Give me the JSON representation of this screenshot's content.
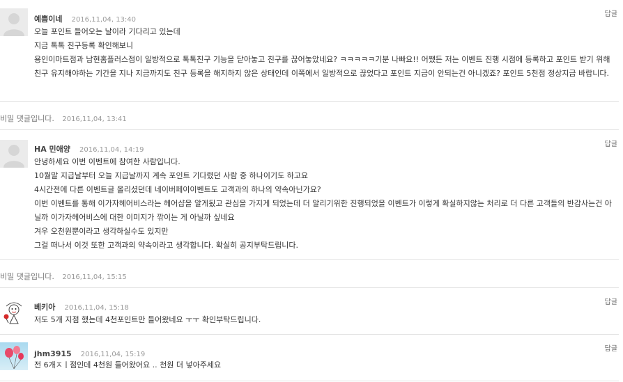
{
  "comments": [
    {
      "author": "예쁨이네",
      "date": "2016,11,04, 13:40",
      "reply_label": "답글",
      "avatar": "default-avatar-icon",
      "lines": [
        "오늘 포인트 들어오는 날이라 기다리고 있는데",
        "지금 톡톡 친구등록 확인해보니",
        "용인이마트점과 남현홈플러스점이 일방적으로 톡톡친구 기능을 닫아놓고 친구를 끊어놓았네요? ㅋㅋㅋㅋㅋ기분 나빠요!! 어쨌든 저는 이벤트 진행 시점에 등록하고 포인트 받기 위해 친구 유지해야하는 기간을 지나 지금까지도 친구 등록을 해지하지 않은 상태인데 이쪽에서 일방적으로 끊었다고 포인트 지급이 안되는건 아니겠죠? 포인트 5천점 정상지급 바랍니다."
      ]
    },
    {
      "author": "HA 민애양",
      "date": "2016,11,04, 14:19",
      "reply_label": "답글",
      "avatar": "default-avatar-icon",
      "lines": [
        "안녕하세요 이번 이벤트에 참여한 사람입니다.",
        "10월말 지급날부터 오늘 지급날까지 계속 포인트 기다렸던 사람 중 하나이기도 하고요",
        "4시간전에 다른 이벤트글 올리셨던데 네이버페이이벤트도 고객과의 하나의 약속아닌가요?",
        "이번 이벤트를 통해 이가자헤어비스라는 헤어샵을 알게됬고 관심을 가지게 되었는데 더 알리기위한 진행되었을 이벤트가 이렇게 확실하지않는 처리로 더 다른 고객들의 반감사는건 아닐까 이가자헤어비스에 대한 이미지가 깎이는 게 아닐까 싶네요",
        "겨우 오천원뿐이라고 생각하실수도 있지만",
        "그걸 떠나서 이것 또한 고객과의 약속이라고 생각합니다. 확실히 공지부탁드립니다."
      ]
    },
    {
      "author": "베키아",
      "date": "2016,11,04, 15:18",
      "reply_label": "답글",
      "avatar": "cartoon-avatar-icon",
      "lines": [
        "저도 5개 지점 했는데 4천포인트만 들어왔네요 ㅜㅜ 확인부탁드립니다."
      ]
    },
    {
      "author": "jhm3915",
      "date": "2016,11,04, 15:19",
      "reply_label": "답글",
      "avatar": "balloon-avatar-icon",
      "lines": [
        "전 6개ㅈㅣ점인데 4천원 들어왔어요 .. 천원 더 넣아주세요"
      ]
    }
  ],
  "secret_comments": [
    {
      "text": "비밀 댓글입니다.",
      "date": "2016,11,04, 13:41"
    },
    {
      "text": "비밀 댓글입니다.",
      "date": "2016,11,04, 15:15"
    }
  ],
  "colors": {
    "avatar_default": "#ebebeb",
    "divider": "#e2e2e2",
    "text": "#333333",
    "date": "#9a9a9a"
  }
}
